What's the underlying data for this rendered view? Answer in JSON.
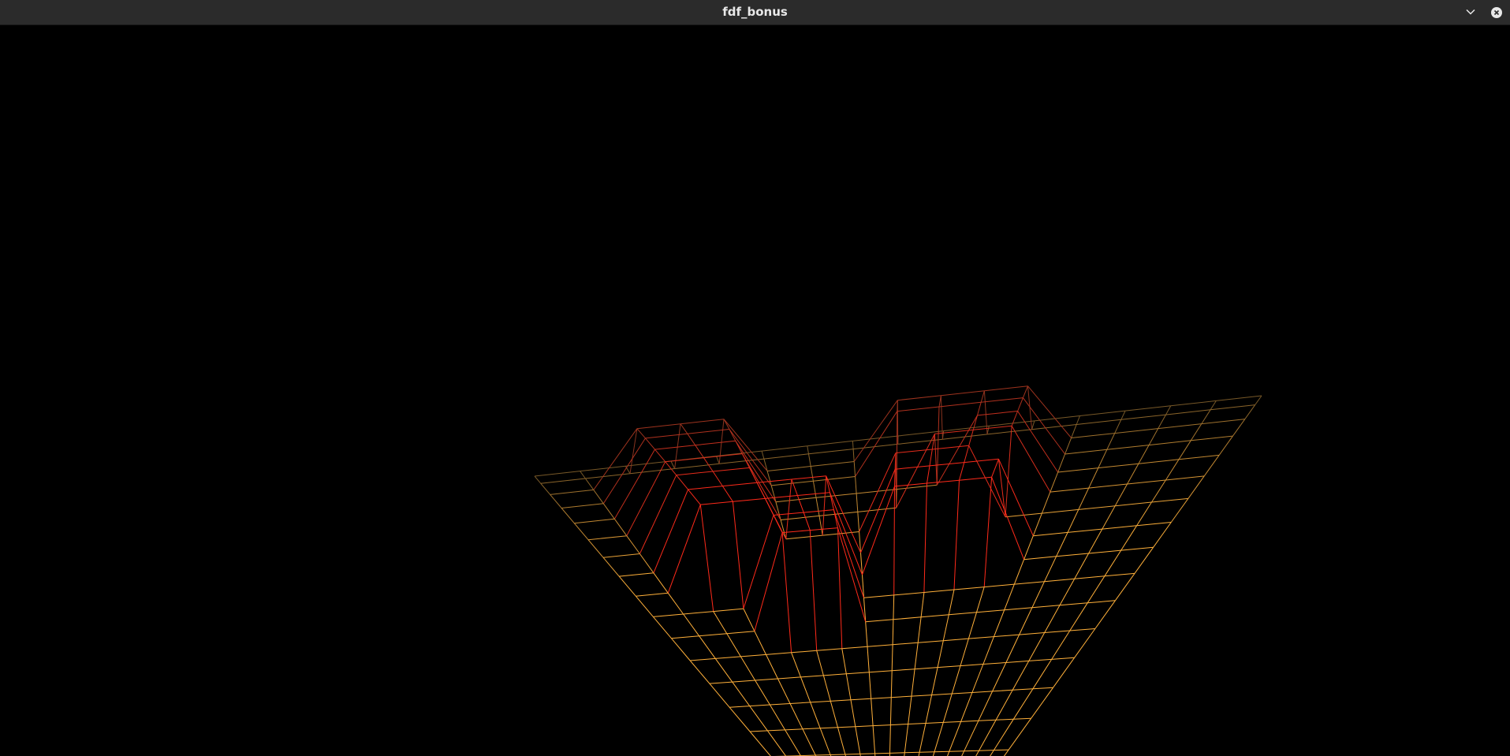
{
  "window": {
    "title": "fdf_bonus"
  },
  "titlebar_buttons": {
    "menu_icon": "chevron-down-icon",
    "close_icon": "close-icon"
  },
  "render": {
    "background_color": "#000000",
    "high_color": "#ff2a1a",
    "low_color": "#ffb03a",
    "far_color": "#4a3a22",
    "grid_cols": 17,
    "grid_rows": 17,
    "heights": [
      [
        0,
        0,
        0,
        0,
        0,
        0,
        0,
        0,
        0,
        0,
        0,
        0,
        0,
        0,
        0,
        0,
        0
      ],
      [
        0,
        0,
        0,
        0,
        0,
        0,
        0,
        0,
        0,
        0,
        0,
        0,
        0,
        0,
        0,
        0,
        0
      ],
      [
        0,
        0,
        10,
        10,
        10,
        0,
        0,
        0,
        10,
        10,
        10,
        10,
        0,
        0,
        0,
        0,
        0
      ],
      [
        0,
        0,
        10,
        10,
        10,
        0,
        0,
        0,
        10,
        10,
        10,
        10,
        0,
        0,
        0,
        0,
        0
      ],
      [
        0,
        0,
        10,
        10,
        10,
        0,
        0,
        0,
        0,
        0,
        10,
        10,
        0,
        0,
        0,
        0,
        0
      ],
      [
        0,
        0,
        10,
        10,
        10,
        0,
        0,
        0,
        0,
        10,
        10,
        10,
        0,
        0,
        0,
        0,
        0
      ],
      [
        0,
        0,
        10,
        10,
        10,
        0,
        0,
        0,
        10,
        10,
        10,
        0,
        0,
        0,
        0,
        0,
        0
      ],
      [
        0,
        0,
        10,
        10,
        10,
        10,
        10,
        0,
        10,
        10,
        10,
        10,
        0,
        0,
        0,
        0,
        0
      ],
      [
        0,
        0,
        10,
        10,
        10,
        10,
        10,
        0,
        10,
        10,
        10,
        10,
        0,
        0,
        0,
        0,
        0
      ],
      [
        0,
        0,
        0,
        0,
        10,
        10,
        10,
        0,
        0,
        0,
        0,
        0,
        0,
        0,
        0,
        0,
        0
      ],
      [
        0,
        0,
        0,
        0,
        10,
        10,
        10,
        0,
        0,
        0,
        0,
        0,
        0,
        0,
        0,
        0,
        0
      ],
      [
        0,
        0,
        0,
        0,
        0,
        0,
        0,
        0,
        0,
        0,
        0,
        0,
        0,
        0,
        0,
        0,
        0
      ],
      [
        0,
        0,
        0,
        0,
        0,
        0,
        0,
        0,
        0,
        0,
        0,
        0,
        0,
        0,
        0,
        0,
        0
      ],
      [
        0,
        0,
        0,
        0,
        0,
        0,
        0,
        0,
        0,
        0,
        0,
        0,
        0,
        0,
        0,
        0,
        0
      ],
      [
        0,
        0,
        0,
        0,
        0,
        0,
        0,
        0,
        0,
        0,
        0,
        0,
        0,
        0,
        0,
        0,
        0
      ],
      [
        0,
        0,
        0,
        0,
        0,
        0,
        0,
        0,
        0,
        0,
        0,
        0,
        0,
        0,
        0,
        0,
        0
      ],
      [
        0,
        0,
        0,
        0,
        0,
        0,
        0,
        0,
        0,
        0,
        0,
        0,
        0,
        0,
        0,
        0,
        0
      ]
    ]
  }
}
